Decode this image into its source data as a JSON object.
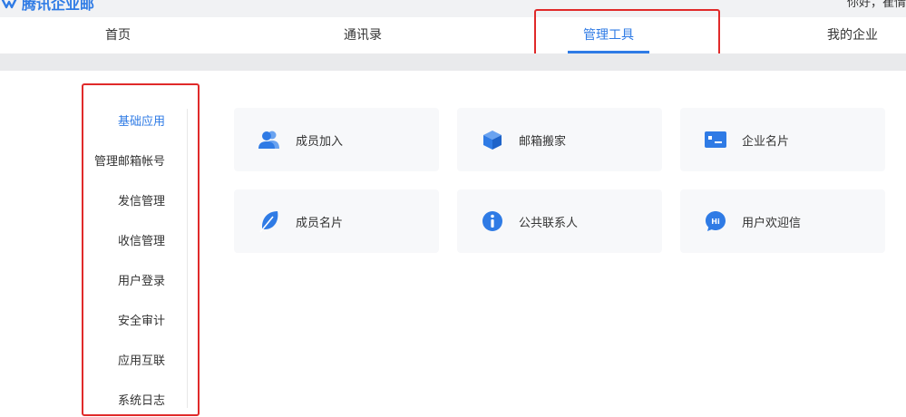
{
  "header": {
    "logo_text": "腾讯企业邮",
    "greeting": "你好，崔情"
  },
  "nav": {
    "tabs": [
      {
        "label": "首页"
      },
      {
        "label": "通讯录"
      },
      {
        "label": "管理工具"
      },
      {
        "label": "我的企业"
      }
    ],
    "active_tab": "管理工具"
  },
  "sidebar": {
    "items": [
      {
        "label": "基础应用"
      },
      {
        "label": "管理邮箱帐号"
      },
      {
        "label": "发信管理"
      },
      {
        "label": "收信管理"
      },
      {
        "label": "用户登录"
      },
      {
        "label": "安全审计"
      },
      {
        "label": "应用互联"
      },
      {
        "label": "系统日志"
      }
    ],
    "active_item": "基础应用"
  },
  "tools": [
    {
      "label": "成员加入",
      "icon": "members-icon"
    },
    {
      "label": "邮箱搬家",
      "icon": "box-icon"
    },
    {
      "label": "企业名片",
      "icon": "card-icon"
    },
    {
      "label": "成员名片",
      "icon": "feather-icon"
    },
    {
      "label": "公共联系人",
      "icon": "info-icon"
    },
    {
      "label": "用户欢迎信",
      "icon": "hi-icon"
    }
  ],
  "colors": {
    "accent": "#2f7be5",
    "highlight": "#e02a2a",
    "card_bg": "#f7f8fa"
  }
}
